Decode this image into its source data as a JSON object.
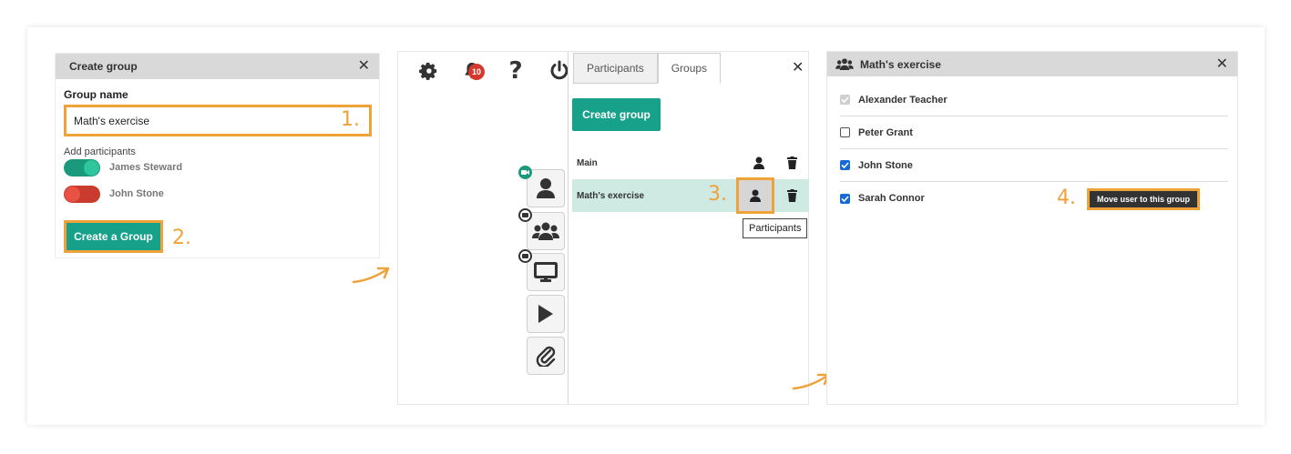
{
  "create_group_panel": {
    "title": "Create group",
    "group_name_label": "Group name",
    "group_name_value": "Math's exercise",
    "add_participants_label": "Add participants",
    "participants": [
      {
        "name": "James Steward",
        "enabled": true
      },
      {
        "name": "John Stone",
        "enabled": false
      }
    ],
    "create_button": "Create a Group",
    "step_1": "1.",
    "step_2": "2."
  },
  "room_panel": {
    "notification_count": "10",
    "tabs": [
      "Participants",
      "Groups"
    ],
    "active_tab": "Groups",
    "create_group_button": "Create group",
    "groups": [
      {
        "name": "Main",
        "selected": false
      },
      {
        "name": "Math's exercise",
        "selected": true
      }
    ],
    "tooltip": "Participants",
    "step_3": "3."
  },
  "group_panel": {
    "title": "Math's exercise",
    "users": [
      {
        "name": "Alexander Teacher",
        "state": "disabled"
      },
      {
        "name": "Peter Grant",
        "state": "unchecked"
      },
      {
        "name": "John Stone",
        "state": "checked"
      },
      {
        "name": "Sarah Connor",
        "state": "checked"
      }
    ],
    "move_button": "Move user to this group",
    "step_4": "4."
  },
  "colors": {
    "accent_orange": "#f0a23a",
    "primary_teal": "#17a08a",
    "toggle_off_red": "#c93a2f",
    "selected_row": "#cfeae3",
    "badge_red": "#d33a2b"
  },
  "icons": [
    "close-icon",
    "gear-icon",
    "bell-icon",
    "question-icon",
    "power-icon",
    "user-icon",
    "users-icon",
    "monitor-icon",
    "play-icon",
    "paperclip-icon",
    "trash-icon",
    "video-camera-icon",
    "arrow-icon"
  ]
}
